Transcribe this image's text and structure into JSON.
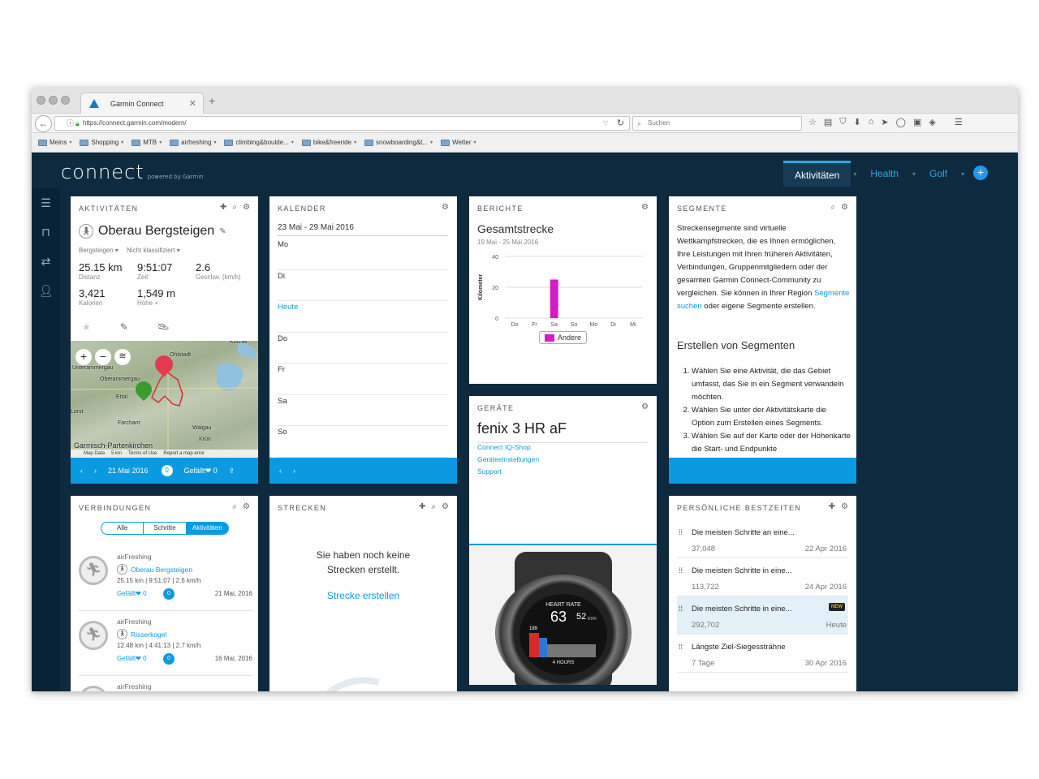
{
  "browser": {
    "tab_title": "Garmin Connect",
    "url": "https://connect.garmin.com/modern/",
    "search_placeholder": "Suchen",
    "bookmarks": [
      "Meins",
      "Shopping",
      "MTB",
      "airfreshing",
      "climbing&boulde...",
      "bike&freeride",
      "snowboarding&t...",
      "Wetter"
    ]
  },
  "app": {
    "logo": "connect",
    "logo_sub": "powered by Garmin",
    "nav": [
      "Aktivitäten",
      "Health",
      "Golf"
    ]
  },
  "activity": {
    "header": "AKTIVITÄTEN",
    "title": "Oberau Bergsteigen",
    "type": "Bergsteigen",
    "class": "Nicht klassifiziert",
    "stats": [
      {
        "value": "25.15 km",
        "label": "Distanz"
      },
      {
        "value": "9:51:07",
        "label": "Zeit"
      },
      {
        "value": "2.6",
        "label": "Geschw. (km/h)"
      },
      {
        "value": "3,421",
        "label": "Kalorien"
      },
      {
        "value": "1,549 m",
        "label": "Höhe +"
      }
    ],
    "map": {
      "places": [
        "Oberammergau",
        "Unterammergau",
        "Ohlstadt",
        "Ettal",
        "Farchant",
        "Garmisch-Partenkirchen",
        "Walgau",
        "Krün",
        "Kochel",
        "Lorst"
      ],
      "footer": [
        "Map Data",
        "5 km",
        "Terms of Use",
        "Report a map error"
      ]
    },
    "date": "21 Mai 2016",
    "comments": "0",
    "likes_label": "Gefällt",
    "likes": "0"
  },
  "calendar": {
    "header": "KALENDER",
    "range": "23 Mai - 29 Mai 2016",
    "days": [
      "Mo",
      "Di",
      "Heute",
      "Do",
      "Fr",
      "Sa",
      "So"
    ]
  },
  "reports": {
    "header": "BERICHTE",
    "title": "Gesamtstrecke",
    "range": "19 Mai - 25 Mai 2016",
    "legend": "Andere"
  },
  "chart_data": {
    "type": "bar",
    "title": "Gesamtstrecke",
    "ylabel": "Kilometer",
    "categories": [
      "Do",
      "Fr",
      "Sa",
      "So",
      "Mo",
      "Di",
      "Mi"
    ],
    "series": [
      {
        "name": "Andere",
        "values": [
          0,
          0,
          25,
          0,
          0,
          0,
          0
        ]
      }
    ],
    "yticks": [
      0,
      20,
      40
    ],
    "ylim": [
      0,
      40
    ],
    "color": "#d11fc7"
  },
  "devices": {
    "header": "GERÄTE",
    "name": "fenix 3 HR aF",
    "links": [
      "Connect IQ-Shop",
      "Geräteeinstellungen",
      "Support"
    ],
    "watch": {
      "label": "HEART RATE",
      "value": "63",
      "sub": "52",
      "sub_unit": "RHR",
      "peak": "189",
      "footer": "4 HOURS"
    }
  },
  "segments": {
    "header": "SEGMENTE",
    "intro_1": "Streckensegmente sind virtuelle Wettkampfstrecken, die es Ihnen ermöglichen, Ihre Leistungen mit Ihren früheren Aktivitäten, Verbindungen, Gruppenmitgliedern oder der gesamten Garmin Connect-Community zu vergleichen. Sie können in Ihrer Region ",
    "link": "Segmente suchen",
    "intro_2": " oder eigene Segmente erstellen.",
    "subtitle": "Erstellen von Segmenten",
    "steps": [
      "Wählen Sie eine Aktivität, die das Gebiet umfasst, das Sie in ein Segment verwandeln möchten.",
      "Wählen Sie unter der Aktivitätskarte die Option zum Erstellen eines Segments.",
      "Wählen Sie auf der Karte oder der Höhenkarte die Start- und Endpunkte"
    ]
  },
  "connections": {
    "header": "VERBINDUNGEN",
    "tabs": [
      "Alle",
      "Schritte",
      "Aktivitäten"
    ],
    "items": [
      {
        "user": "airFreshing",
        "activity": "Oberau Bergsteigen",
        "stats": "25.15 km | 9:51:07 | 2.6 km/h",
        "likes": "Gefällt",
        "likes_count": "0",
        "comments": "0",
        "date": "21 Mai, 2016"
      },
      {
        "user": "airFreshing",
        "activity": "Risserkogel",
        "stats": "12.48 km | 4:41:13 | 2.7 km/h",
        "likes": "Gefällt",
        "likes_count": "0",
        "comments": "0",
        "date": "16 Mai, 2016"
      },
      {
        "user": "airFreshing"
      }
    ]
  },
  "courses": {
    "header": "STRECKEN",
    "empty_text": "Sie haben noch keine Strecken erstellt.",
    "create_link": "Strecke erstellen"
  },
  "records": {
    "header": "PERSÖNLICHE BESTZEITEN",
    "items": [
      {
        "title": "Die meisten Schritte an eine...",
        "value": "37,048",
        "date": "22 Apr 2016"
      },
      {
        "title": "Die meisten Schritte in eine...",
        "value": "113,722",
        "date": "24 Apr 2016"
      },
      {
        "title": "Die meisten Schritte in eine...",
        "value": "292,702",
        "date": "Heute",
        "badge": "NEW"
      },
      {
        "title": "Längste Ziel-Siegessträhne",
        "value": "7 Tage",
        "date": "30 Apr 2016"
      }
    ]
  }
}
